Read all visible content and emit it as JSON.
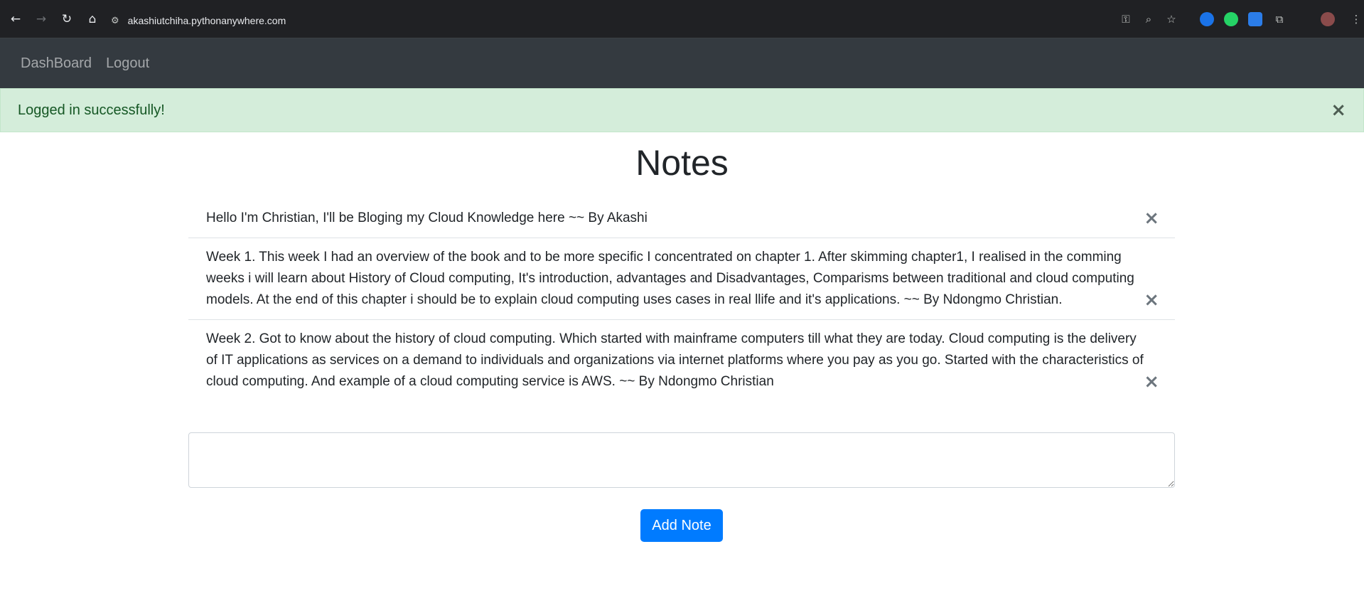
{
  "browser": {
    "url": "akashiutchiha.pythonanywhere.com",
    "back_icon": "←",
    "forward_icon": "→",
    "reload_icon": "↻",
    "home_icon": "⌂",
    "site_info_icon": "⚙",
    "password_icon": "⚿",
    "zoom_icon": "⌕",
    "bookmark_icon": "☆",
    "extensions_icon": "⧉"
  },
  "navbar": {
    "items": [
      {
        "label": "DashBoard"
      },
      {
        "label": "Logout"
      }
    ]
  },
  "alert": {
    "message": "Logged in successfully!",
    "close": "×",
    "color": "#155724",
    "background": "#d4edda"
  },
  "main": {
    "title": "Notes",
    "notes": [
      {
        "text": "Hello I'm Christian, I'll be Bloging my Cloud Knowledge here ~~ By Akashi",
        "close": "×"
      },
      {
        "text": "Week 1. This week I had an overview of the book and to be more specific I concentrated on chapter 1. After skimming chapter1, I realised in the comming weeks i will learn about History of Cloud computing, It's introduction, advantages and Disadvantages, Comparisms between traditional and cloud computing models. At the end of this chapter i should be to explain cloud computing uses cases in real llife and it's applications. ~~ By Ndongmo Christian.",
        "close": "×"
      },
      {
        "text": "Week 2. Got to know about the history of cloud computing. Which started with mainframe computers till what they are today. Cloud computing is the delivery of IT applications as services on a demand to individuals and organizations via internet platforms where you pay as you go. Started with the characteristics of cloud computing. And example of a cloud computing service is AWS. ~~ By Ndongmo Christian",
        "close": "×"
      }
    ],
    "input_value": "",
    "add_button_label": "Add Note",
    "accent": "#007bff"
  }
}
